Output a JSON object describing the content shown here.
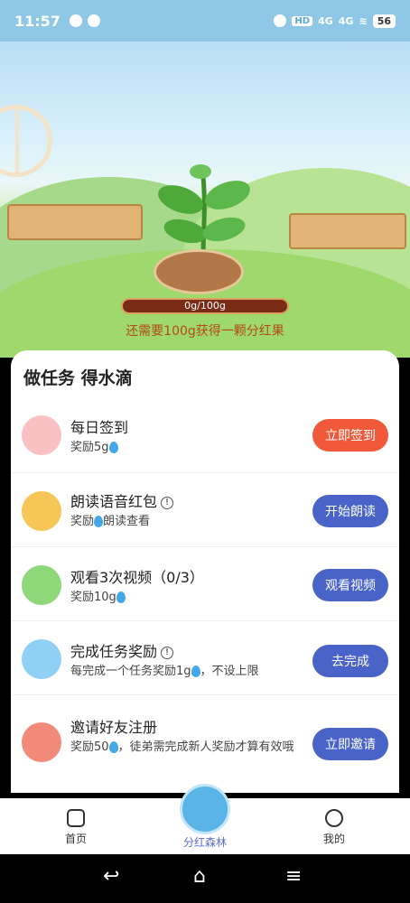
{
  "status": {
    "time": "11:57",
    "net1": "4G",
    "net2": "4G",
    "hd": "HD",
    "battery": "56"
  },
  "scene": {
    "progress": "0g/100g",
    "progress_fraction": 0,
    "note": "还需要100g获得一颗分红果"
  },
  "card": {
    "title": "做任务 得水滴",
    "tasks": [
      {
        "title": "每日签到",
        "sub_prefix": "奖励5g",
        "button": "立即签到",
        "color": "#f05a3a"
      },
      {
        "title": "朗读语音红包",
        "sub_prefix": "奖励",
        "sub_suffix": "朗读查看",
        "button": "开始朗读",
        "color": "#4a63c8"
      },
      {
        "title": "观看3次视频（0/3）",
        "sub_prefix": "奖励10g",
        "button": "观看视频",
        "color": "#4a63c8"
      },
      {
        "title": "完成任务奖励",
        "sub_prefix": "每完成一个任务奖励1g",
        "sub_suffix": "，不设上限",
        "button": "去完成",
        "color": "#4a63c8"
      },
      {
        "title": "邀请好友注册",
        "sub_prefix": "奖励50",
        "sub_suffix": "，徒弟需完成新人奖励才算有效哦",
        "button": "立即邀请",
        "color": "#4a63c8"
      }
    ]
  },
  "nav": {
    "home": "首页",
    "forest": "分红森林",
    "mine": "我的"
  }
}
